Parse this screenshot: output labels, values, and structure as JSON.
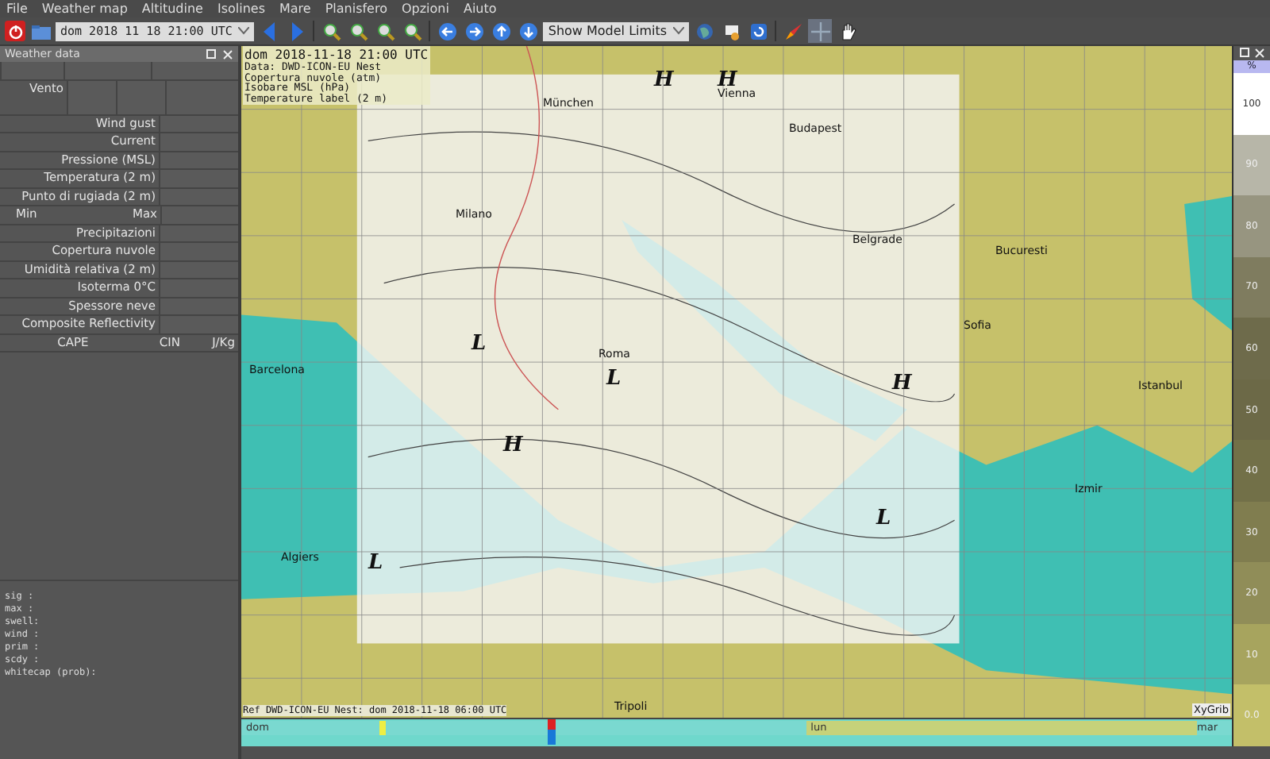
{
  "menu": [
    "File",
    "Weather map",
    "Altitudine",
    "Isolines",
    "Mare",
    "Planisfero",
    "Opzioni",
    "Aiuto"
  ],
  "toolbar": {
    "date": "dom 2018 11 18 21:00 UTC",
    "limits": "Show Model Limits"
  },
  "panel": {
    "title": "Weather data",
    "rows": [
      {
        "kind": "blank"
      },
      {
        "kind": "wind",
        "label": "Vento"
      },
      {
        "kind": "field",
        "label": "Wind gust"
      },
      {
        "kind": "field",
        "label": "Current"
      },
      {
        "kind": "field",
        "label": "Pressione (MSL)"
      },
      {
        "kind": "field",
        "label": "Temperatura (2 m)"
      },
      {
        "kind": "field",
        "label": "Punto di rugiada (2 m)"
      },
      {
        "kind": "minmax",
        "label": "Min",
        "label2": "Max"
      },
      {
        "kind": "field",
        "label": "Precipitazioni"
      },
      {
        "kind": "field",
        "label": "Copertura nuvole"
      },
      {
        "kind": "field",
        "label": "Umidità relativa (2 m)"
      },
      {
        "kind": "field",
        "label": "Isoterma 0°C"
      },
      {
        "kind": "field",
        "label": "Spessore neve"
      },
      {
        "kind": "field",
        "label": "Composite Reflectivity"
      },
      {
        "kind": "cape",
        "label": "CAPE",
        "label2": "CIN",
        "label3": "J/Kg"
      }
    ],
    "wave_lines": [
      "sig  :",
      "max  :",
      "swell:",
      "wind :",
      "prim :",
      "scdy :",
      "whitecap (prob):"
    ]
  },
  "map": {
    "info": [
      "dom 2018-11-18 21:00 UTC",
      "Data: DWD-ICON-EU Nest",
      "Copertura nuvole (atm)",
      "Isobare MSL (hPa)",
      "Temperature label (2 m)"
    ],
    "cities": [
      "München",
      "Vienna",
      "Budapest",
      "Milano",
      "Belgrade",
      "Bucuresti",
      "Roma",
      "Sofia",
      "Barcelona",
      "Istanbul",
      "Izmir",
      "Algiers",
      "Tripoli"
    ],
    "pressure_marks": [
      "H",
      "H",
      "L",
      "H",
      "L",
      "H",
      "L",
      "L"
    ],
    "ref": "Ref DWD-ICON-EU Nest: dom 2018-11-18 06:00 UTC",
    "brand": "XyGrib"
  },
  "colorbar": {
    "unit": "%",
    "steps": [
      {
        "label": "100",
        "color": "#ffffff"
      },
      {
        "label": "90",
        "color": "#b7b6a8"
      },
      {
        "label": "80",
        "color": "#979580"
      },
      {
        "label": "70",
        "color": "#7f7c5f"
      },
      {
        "label": "60",
        "color": "#6e6b4b"
      },
      {
        "label": "50",
        "color": "#6c6947"
      },
      {
        "label": "40",
        "color": "#727048"
      },
      {
        "label": "30",
        "color": "#807d4f"
      },
      {
        "label": "20",
        "color": "#908d58"
      },
      {
        "label": "10",
        "color": "#a7a45e"
      },
      {
        "label": "0.0",
        "color": "#c3bf69"
      }
    ]
  },
  "timeline": {
    "days": [
      {
        "label": "dom",
        "selected": false
      },
      {
        "label": "lun",
        "selected": true
      },
      {
        "label": "mar",
        "selected": false
      }
    ],
    "level": 0.31
  }
}
